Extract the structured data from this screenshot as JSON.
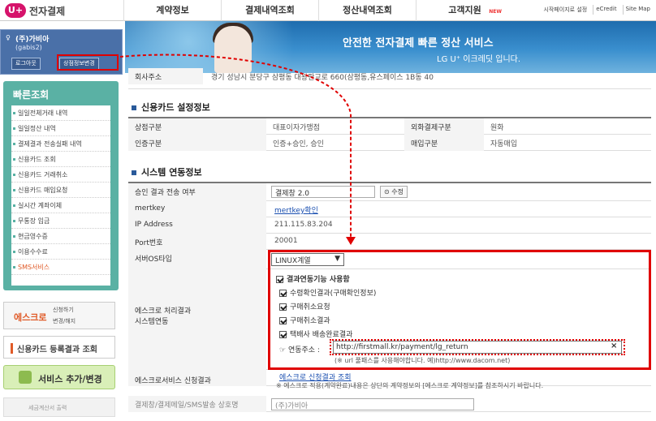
{
  "logo": {
    "badge": "U+",
    "text": "전자결제"
  },
  "gnb": [
    "계약정보",
    "결제내역조회",
    "정산내역조회",
    "고객지원"
  ],
  "gnb_new": "NEW",
  "util": [
    "시작페이지로 설정",
    "eCredit",
    "Site Map"
  ],
  "user": {
    "name": "(주)가비아",
    "id": "(gabis2)",
    "logout": "로그아웃",
    "edit": "상점정보변경"
  },
  "banner": {
    "line1": "안전한 전자결제 빠른 정산 서비스",
    "line2": "LG U⁺ 이크레딧 입니다."
  },
  "quick": {
    "title": "빠른조회",
    "items": [
      "일일전체거래 내역",
      "일일정산 내역",
      "결제결과 전송실패 내역",
      "신용카드 조회",
      "신용카드 거래취소",
      "신용카드 매입요청",
      "실시간 계좌이체",
      "무통장 입금",
      "현금영수증",
      "이용수수료",
      "SMS서비스"
    ]
  },
  "side": {
    "escrow_title": "에스크로",
    "escrow_sub1": "신청하기",
    "escrow_sub2": "변경/해지",
    "card_title": "신용카드 등록결과 조회",
    "service_title": "서비스 추가/변경",
    "bottom": "세금계산서 출력"
  },
  "addr": {
    "label": "회사주소",
    "value": "경기 성남시 분당구 삼평동 대왕판교로 660(삼평동,유스페이스 1B동 40"
  },
  "card_info": {
    "title": "신용카드 설정정보",
    "rows": [
      {
        "l1": "상점구분",
        "v1": "대표이자가맹점",
        "l2": "외화결제구분",
        "v2": "원화"
      },
      {
        "l1": "인증구분",
        "v1": "인증+승인, 승인",
        "l2": "매입구분",
        "v2": "자동매입"
      }
    ]
  },
  "system": {
    "title": "시스템 연동정보",
    "approval_label": "승인 결과 전송 여부",
    "approval_value": "결제창 2.0",
    "modify_btn": "수정",
    "mertkey_label": "mertkey",
    "mertkey_link": "mertkey확인",
    "ip_label": "IP Address",
    "ip_value": "211.115.83.204",
    "port_label": "Port번호",
    "port_value": "20001",
    "os_label": "서버OS타입",
    "os_value": "LINUX계열",
    "escrow_label1": "에스크로 처리결과",
    "escrow_label2": "시스템연동",
    "escrow_main": "결과연동기능 사용함",
    "escrow_opts": [
      "수령확인결과(구매확인정보)",
      "구매취소요청",
      "구매취소결과",
      "택배사 배송완료결과"
    ],
    "url_label": "연동주소 :",
    "url_value": "http://firstmall.kr/payment/lg_return",
    "url_note": "(※ url 풀패스를 사용해야합니다. 예)http://www.dacom.net)",
    "svc_label": "에스크로서비스 신청결과",
    "svc_link": "에스크로 신청결과 조회",
    "svc_note": "※ 에스크로 적용(계약완료)내용은 상단의 계약정보의 [에스크로 계약정보]를 참조하시기 바랍니다.",
    "name_label": "결제창/결제메일/SMS발송 상호명",
    "name_value": "(주)가비아"
  },
  "colors": {
    "highlight": "#e00000",
    "teal": "#5ab1a4",
    "brand": "#d6136b"
  }
}
